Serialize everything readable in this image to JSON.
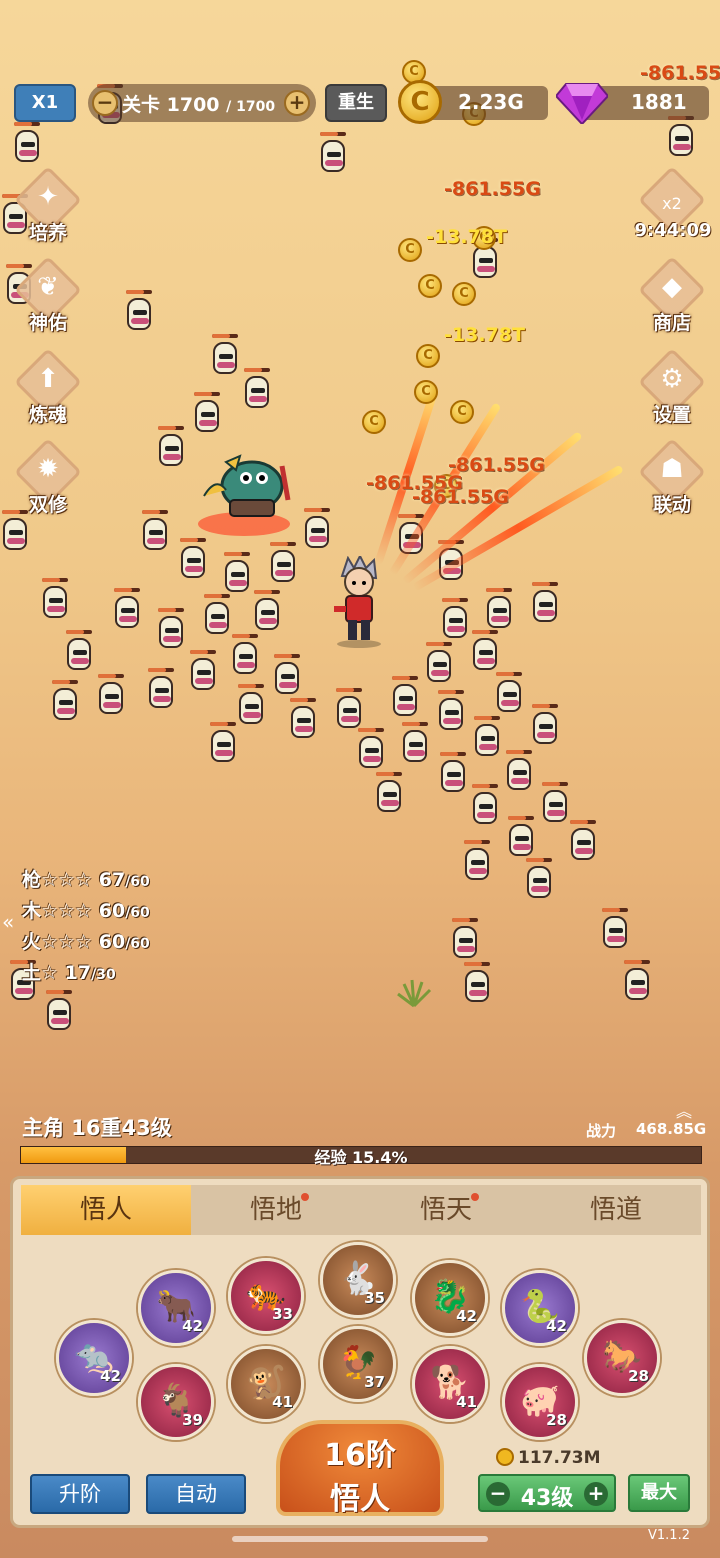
{
  "top_bar": {
    "speed_label": "X1",
    "stage_label": "关卡",
    "stage_current": "1700",
    "stage_total": "/ 1700",
    "rebirth_label": "重生",
    "gold_amount": "2.23G",
    "gem_amount": "1881"
  },
  "left_menu": [
    {
      "label": "培养",
      "icon": "cultivate-icon"
    },
    {
      "label": "神佑",
      "icon": "blessing-icon"
    },
    {
      "label": "炼魂",
      "icon": "soul-forge-icon"
    },
    {
      "label": "双修",
      "icon": "dual-cultivation-icon"
    }
  ],
  "right_menu": [
    {
      "label": "x2",
      "icon": "double-reward-icon"
    },
    {
      "label": "商店",
      "icon": "shop-icon"
    },
    {
      "label": "设置",
      "icon": "settings-icon"
    },
    {
      "label": "联动",
      "icon": "collab-icon"
    }
  ],
  "boost_timer": "9:44:09",
  "damage_numbers": [
    "-861.55G",
    "-861.55G",
    "-13.78T",
    "-13.78T",
    "-861.55G",
    "-861.55G",
    "-861.55G"
  ],
  "elements": [
    {
      "name": "枪☆☆☆",
      "value": "67",
      "max": "/60"
    },
    {
      "name": "木☆☆☆",
      "value": "60",
      "max": "/60"
    },
    {
      "name": "火☆☆☆",
      "value": "60",
      "max": "/60"
    },
    {
      "name": "土☆",
      "value": "17",
      "max": "/30"
    }
  ],
  "hero": {
    "level_text": "主角 16重43级",
    "power_label": "战力",
    "power_value": "468.85G",
    "xp_text": "经验 15.4%",
    "xp_percent": 15.4
  },
  "tabs": [
    {
      "label": "悟人",
      "active": true
    },
    {
      "label": "悟地",
      "active": false
    },
    {
      "label": "悟天",
      "active": false
    },
    {
      "label": "悟道",
      "active": false
    }
  ],
  "zodiac": [
    {
      "name": "rat",
      "level": "42"
    },
    {
      "name": "ox",
      "level": "42"
    },
    {
      "name": "tiger",
      "level": "33"
    },
    {
      "name": "rabbit",
      "level": "35"
    },
    {
      "name": "dragon",
      "level": "42"
    },
    {
      "name": "snake",
      "level": "42"
    },
    {
      "name": "horse",
      "level": "28"
    },
    {
      "name": "goat",
      "level": "39"
    },
    {
      "name": "monkey",
      "level": "41"
    },
    {
      "name": "rooster",
      "level": "37"
    },
    {
      "name": "dog",
      "level": "41"
    },
    {
      "name": "pig",
      "level": "28"
    }
  ],
  "actions": {
    "upgrade_label": "升阶",
    "auto_label": "自动",
    "main_line1": "16阶",
    "main_line2": "悟人",
    "cost": "117.73M",
    "level_value": "43级",
    "max_label": "最大"
  },
  "version": "V1.1.2"
}
